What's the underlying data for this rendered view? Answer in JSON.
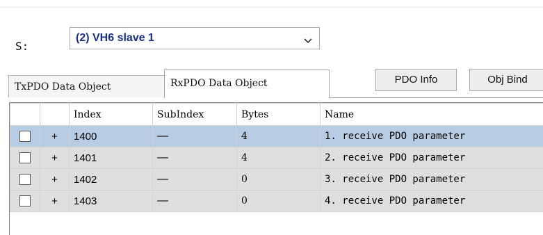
{
  "slave": {
    "label": "S:",
    "selected": "(2)  VH6 slave 1"
  },
  "tabs": [
    {
      "label": "TxPDO Data Object",
      "active": false
    },
    {
      "label": "RxPDO Data Object",
      "active": true
    }
  ],
  "buttons": {
    "pdo_info": "PDO Info",
    "obj_bind": "Obj Bind"
  },
  "table": {
    "columns": [
      "",
      "",
      "Index",
      "SubIndex",
      "Bytes",
      "Name"
    ],
    "rows": [
      {
        "expand": "+",
        "index": "1400",
        "subindex": "—",
        "bytes": "4",
        "name": "1. receive PDO parameter",
        "selected": true,
        "checked": false
      },
      {
        "expand": "+",
        "index": "1401",
        "subindex": "—",
        "bytes": "4",
        "name": "2. receive PDO parameter",
        "selected": false,
        "checked": false
      },
      {
        "expand": "+",
        "index": "1402",
        "subindex": "—",
        "bytes": "0",
        "name": "3. receive PDO parameter",
        "selected": false,
        "checked": false
      },
      {
        "expand": "+",
        "index": "1403",
        "subindex": "—",
        "bytes": "0",
        "name": "4. receive PDO parameter",
        "selected": false,
        "checked": false
      }
    ]
  },
  "colors": {
    "selected_row": "#b8cce3",
    "row_bg": "#dedede",
    "select_text": "#1a2f8a"
  },
  "icons": {
    "dropdown": "chevron-down-icon",
    "checkbox": "checkbox-icon"
  }
}
